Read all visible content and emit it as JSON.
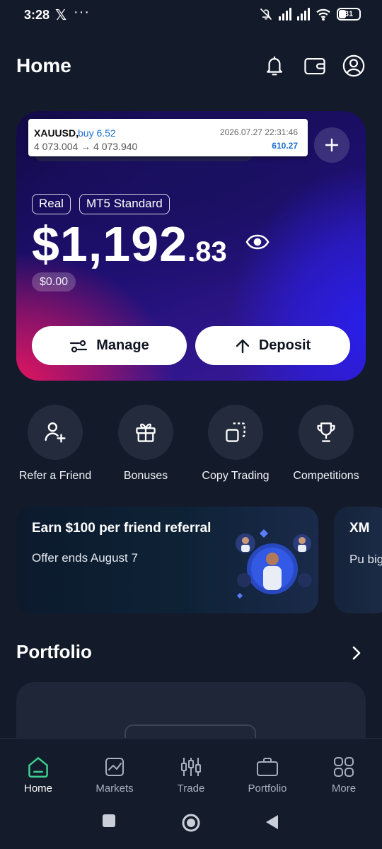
{
  "status": {
    "time": "3:28",
    "notif_icons": [
      "x-logo-icon",
      "more-dots-icon"
    ],
    "battery_level": "31"
  },
  "header": {
    "title": "Home",
    "icons": [
      "bell-icon",
      "wallet-icon",
      "profile-icon"
    ]
  },
  "ticker": {
    "symbol": "XAUUSD,",
    "side": "buy 6.52",
    "prices": "4 073.004 → 4 073.940",
    "timestamp": "2026.07.27 22:31:46",
    "profit": "610.27"
  },
  "account": {
    "type_chip": "Real",
    "platform_chip": "MT5 Standard",
    "balance_main": "$1,192",
    "balance_cents": ".83",
    "pnl": "$0.00",
    "manage_label": "Manage",
    "deposit_label": "Deposit"
  },
  "quick_actions": [
    {
      "label": "Refer a Friend",
      "icon": "add-user-icon"
    },
    {
      "label": "Bonuses",
      "icon": "gift-icon"
    },
    {
      "label": "Copy Trading",
      "icon": "copy-icon"
    },
    {
      "label": "Competitions",
      "icon": "trophy-icon"
    }
  ],
  "promos": [
    {
      "title": "Earn $100 per friend referral",
      "subtitle": "Offer ends August 7"
    },
    {
      "title": "XM",
      "subtitle": "Pu big"
    }
  ],
  "portfolio": {
    "title": "Portfolio"
  },
  "bottom_nav": [
    {
      "label": "Home",
      "active": true
    },
    {
      "label": "Markets",
      "active": false
    },
    {
      "label": "Trade",
      "active": false
    },
    {
      "label": "Portfolio",
      "active": false
    },
    {
      "label": "More",
      "active": false
    }
  ],
  "colors": {
    "background": "#131a2a",
    "accent_green": "#3ccf8e",
    "ticker_blue": "#1a6fd1"
  }
}
